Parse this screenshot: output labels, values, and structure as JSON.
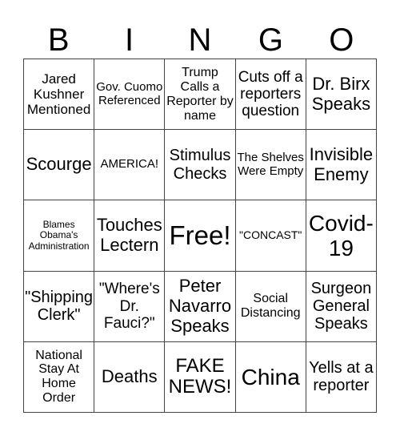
{
  "header": {
    "letters": [
      "B",
      "I",
      "N",
      "G",
      "O"
    ]
  },
  "board": {
    "cells": [
      [
        "Jared Kushner Mentioned",
        "Gov. Cuomo Referenced",
        "Trump Calls a Reporter by name",
        "Cuts off a reporters question",
        "Dr. Birx Speaks"
      ],
      [
        "Scourge",
        "AMERICA!",
        "Stimulus Checks",
        "The Shelves Were Empty",
        "Invisible Enemy"
      ],
      [
        "Blames Obama's Administration",
        "Touches Lectern",
        "Free!",
        "\"CONCAST\"",
        "Covid-19"
      ],
      [
        "\"Shipping Clerk\"",
        "\"Where's Dr. Fauci?\"",
        "Peter Navarro Speaks",
        "Social Distancing",
        "Surgeon General Speaks"
      ],
      [
        "National Stay At Home Order",
        "Deaths",
        "FAKE NEWS!",
        "China",
        "Yells at a reporter"
      ]
    ]
  }
}
